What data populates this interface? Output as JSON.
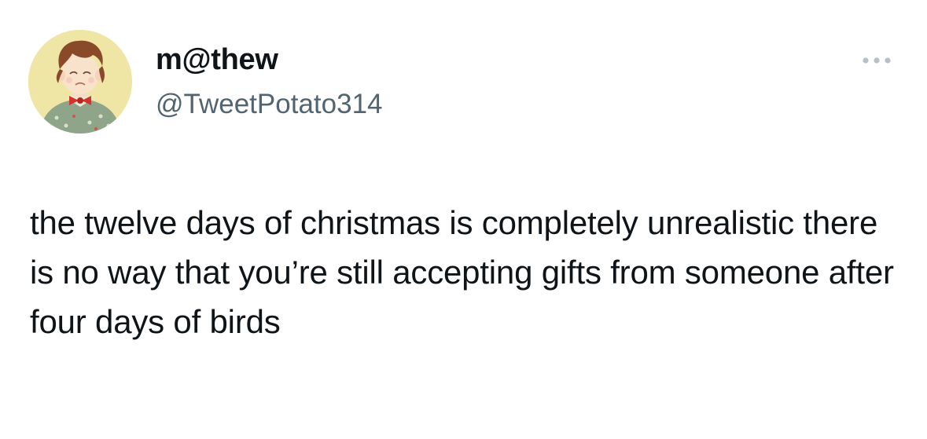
{
  "tweet": {
    "author": {
      "display_name": "m@thew",
      "handle": "@TweetPotato314",
      "avatar_icon": "cartoon-child-avatar-icon"
    },
    "more_icon": "more-options-icon",
    "text": "the twelve days of christmas is completely unrealistic there is no way that you’re still accepting gifts from someone after four days of birds"
  },
  "colors": {
    "text_primary": "#0f1419",
    "text_secondary": "#536471",
    "background": "#ffffff",
    "avatar_background": "#efe6a6"
  }
}
